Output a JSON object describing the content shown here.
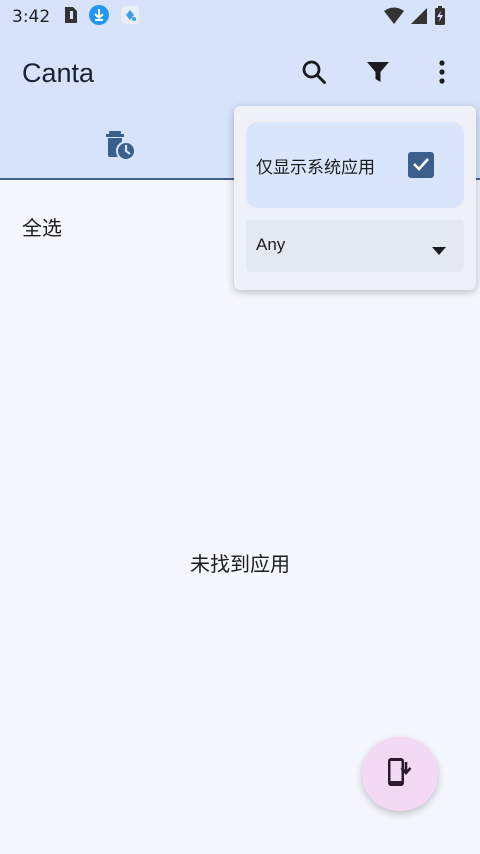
{
  "status_bar": {
    "time": "3:42",
    "left_icons": [
      "sim-card-icon",
      "download-icon",
      "app-notification-icon"
    ],
    "right_icons": [
      "wifi-icon",
      "cellular-signal-icon",
      "battery-charging-icon"
    ]
  },
  "app_bar": {
    "title": "Canta",
    "actions": [
      "search-icon",
      "filter-icon",
      "more-vertical-icon"
    ]
  },
  "tabs": {
    "items": [
      {
        "icon": "uninstalled-history-icon"
      }
    ]
  },
  "content": {
    "select_all_label": "全选",
    "empty_message": "未找到应用"
  },
  "filter_menu": {
    "system_apps_label": "仅显示系统应用",
    "system_apps_checked": true,
    "select_value": "Any"
  },
  "fab": {
    "icon": "install-to-phone-icon"
  },
  "colors": {
    "app_bar_bg": "#d6e3fa",
    "page_bg": "#f4f7fd",
    "accent": "#3b5f8c",
    "fab_bg": "#f2d9f4"
  }
}
